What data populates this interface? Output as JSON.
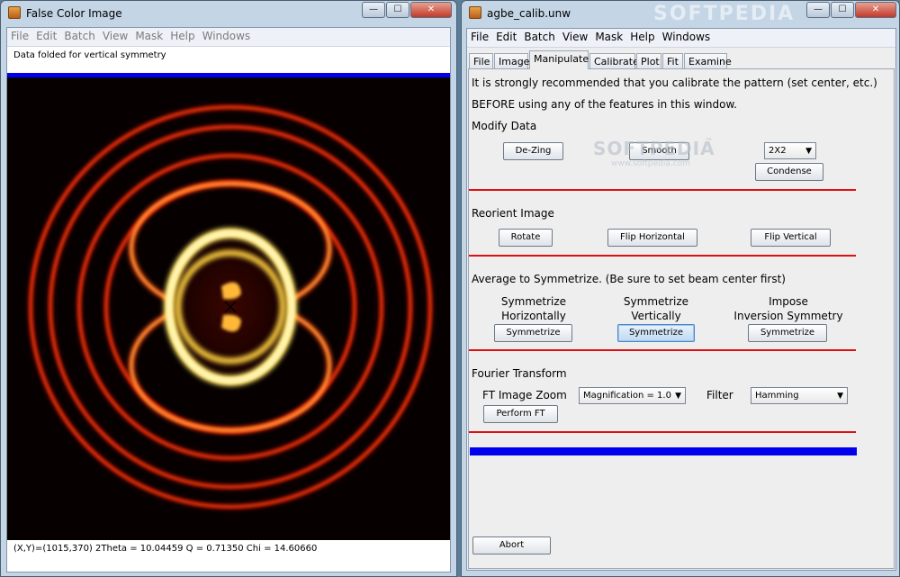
{
  "left_window": {
    "title": "False Color Image",
    "menu": [
      "File",
      "Edit",
      "Batch",
      "View",
      "Mask",
      "Help",
      "Windows"
    ],
    "status": "Data folded for vertical symmetry",
    "coords": "(X,Y)=(1015,370)  2Theta = 10.04459 Q = 0.71350 Chi = 14.60660"
  },
  "right_window": {
    "title": "agbe_calib.unw",
    "menu": [
      "File",
      "Edit",
      "Batch",
      "View",
      "Mask",
      "Help",
      "Windows"
    ],
    "tabs": [
      "File",
      "Image",
      "Manipulate",
      "Calibrate",
      "Plot",
      "Fit",
      "Examine"
    ],
    "active_tab": "Manipulate",
    "note_line1": "It is strongly recommended that you calibrate the pattern (set center, etc.)",
    "note_line2": "BEFORE using any of the features in this window.",
    "modify": {
      "heading": "Modify Data",
      "dezing": "De-Zing",
      "smooth": "Smooth",
      "size": "2X2",
      "condense": "Condense"
    },
    "reorient": {
      "heading": "Reorient Image",
      "rotate": "Rotate",
      "flip_h": "Flip Horizontal",
      "flip_v": "Flip Vertical"
    },
    "symmetrize": {
      "heading": "Average to Symmetrize. (Be sure to set beam center first)",
      "h_l1": "Symmetrize",
      "h_l2": "Horizontally",
      "v_l1": "Symmetrize",
      "v_l2": "Vertically",
      "i_l1": "Impose",
      "i_l2": "Inversion Symmetry",
      "button": "Symmetrize"
    },
    "fourier": {
      "heading": "Fourier Transform",
      "zoom_label": "FT Image Zoom",
      "magnification": "Magnification = 1.0",
      "filter_label": "Filter",
      "filter": "Hamming",
      "perform": "Perform FT"
    },
    "abort": "Abort"
  },
  "watermark": {
    "brand": "SOFTPEDIA",
    "url": "www.softpedia.com",
    "mark": "™"
  },
  "window_buttons": {
    "minimize": "—",
    "maximize": "☐",
    "close": "✕"
  },
  "colors": {
    "progress_blue": "#0000ee",
    "divider_red": "#dd1111",
    "ring_hot": "#ffe060",
    "ring_mid": "#ff3a10"
  }
}
